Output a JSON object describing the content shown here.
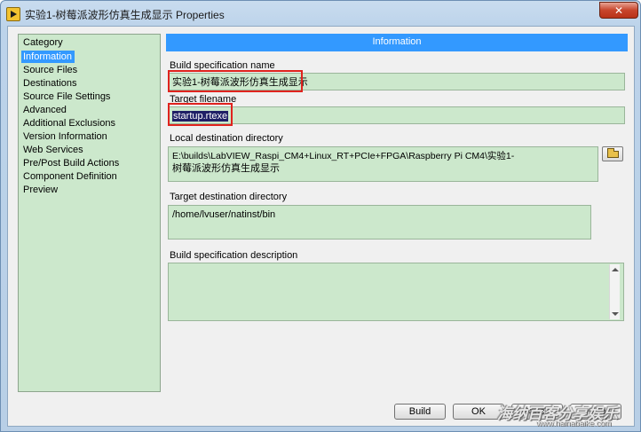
{
  "window": {
    "title": "实验1-树莓派波形仿真生成显示 Properties",
    "close_label": "✕"
  },
  "sidebar": {
    "title": "Category",
    "items": [
      {
        "label": "Information",
        "selected": true
      },
      {
        "label": "Source Files"
      },
      {
        "label": "Destinations"
      },
      {
        "label": "Source File Settings"
      },
      {
        "label": "Advanced"
      },
      {
        "label": "Additional Exclusions"
      },
      {
        "label": "Version Information"
      },
      {
        "label": "Web Services"
      },
      {
        "label": "Pre/Post Build Actions"
      },
      {
        "label": "Component Definition"
      },
      {
        "label": "Preview"
      }
    ]
  },
  "main": {
    "header": "Information",
    "build_spec_name": {
      "label": "Build specification name",
      "value": "实验1-树莓派波形仿真生成显示"
    },
    "target_filename": {
      "label": "Target filename",
      "value": "startup.rtexe"
    },
    "local_dest_dir": {
      "label": "Local destination directory",
      "line1": "E:\\builds\\LabVIEW_Raspi_CM4+Linux_RT+PCIe+FPGA\\Raspberry Pi CM4\\实验1-",
      "line2": "树莓派波形仿真生成显示"
    },
    "target_dest_dir": {
      "label": "Target destination directory",
      "value": "/home/lvuser/natinst/bin"
    },
    "build_spec_desc": {
      "label": "Build specification description",
      "value": ""
    }
  },
  "footer": {
    "build_label": "Build",
    "ok_label": "OK",
    "cancel_label": "Cancel",
    "help_label": "Help"
  },
  "watermark": {
    "text": "海纳百客分享娱乐",
    "url": "www.hainabaike.com"
  },
  "colors": {
    "accent": "#3399ff",
    "field_bg": "#cce8cc",
    "highlight_border": "#e0231e"
  }
}
